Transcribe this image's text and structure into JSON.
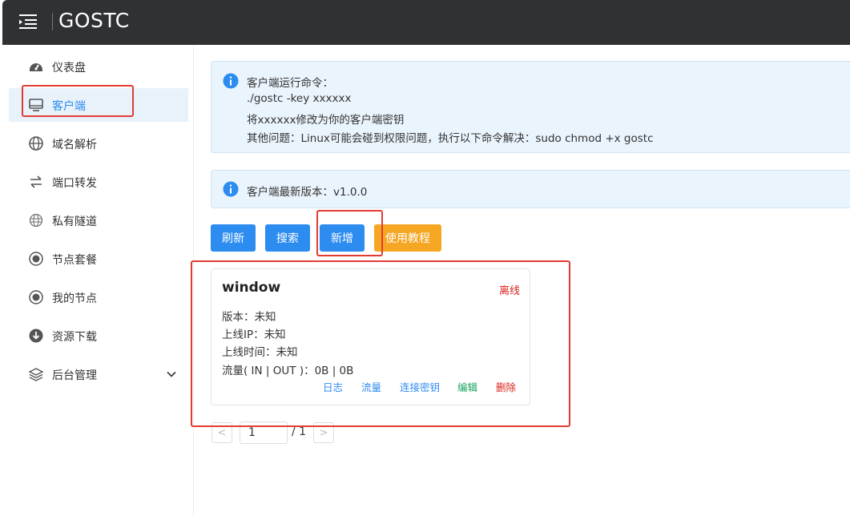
{
  "header": {
    "title": "GOSTC"
  },
  "sidebar": {
    "items": [
      {
        "label": "仪表盘",
        "icon": "dashboard-icon"
      },
      {
        "label": "客户端",
        "icon": "monitor-icon"
      },
      {
        "label": "域名解析",
        "icon": "globe-icon"
      },
      {
        "label": "端口转发",
        "icon": "swap-arrows-icon"
      },
      {
        "label": "私有隧道",
        "icon": "network-globe-icon"
      },
      {
        "label": "节点套餐",
        "icon": "radio-icon"
      },
      {
        "label": "我的节点",
        "icon": "radio-icon"
      },
      {
        "label": "资源下载",
        "icon": "download-icon"
      },
      {
        "label": "后台管理",
        "icon": "layers-icon"
      }
    ]
  },
  "alerts": {
    "run": {
      "lines": [
        "客户端运行命令：",
        "./gostc -key xxxxxx",
        "将xxxxxx修改为你的客户端密钥",
        "其他问题：Linux可能会碰到权限问题，执行以下命令解决：sudo chmod +x gostc"
      ]
    },
    "version": {
      "text": "客户端最新版本：v1.0.0"
    }
  },
  "toolbar": {
    "refresh": "刷新",
    "search": "搜索",
    "add": "新增",
    "tutorial": "使用教程"
  },
  "client_card": {
    "name": "window",
    "status": "离线",
    "version": "版本：未知",
    "ip": "上线IP：未知",
    "online_time": "上线时间：未知",
    "traffic": "流量( IN | OUT )：0B | 0B",
    "actions": {
      "log": "日志",
      "traffic": "流量",
      "key": "连接密钥",
      "edit": "编辑",
      "delete": "删除"
    }
  },
  "pagination": {
    "current": "1",
    "total": "/ 1",
    "prev": "<",
    "next": ">"
  },
  "colors": {
    "primary": "#2d8cf0",
    "warning": "#f5a623",
    "danger": "#d9221c",
    "success": "#19a15f",
    "header": "#303133",
    "highlight": "#e23b34"
  }
}
